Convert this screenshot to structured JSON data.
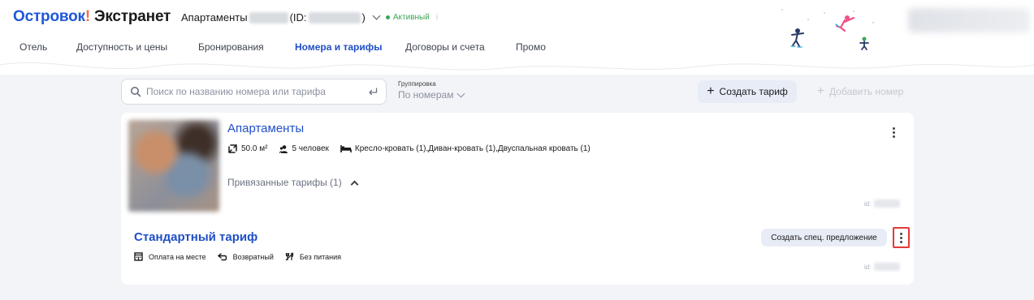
{
  "header": {
    "brand": "Островок",
    "brand_excl": "!",
    "product": "Экстранет",
    "property_type": "Апартаменты",
    "id_prefix": "(ID:",
    "id_suffix": ")",
    "status": "Активный",
    "info_icon": "i"
  },
  "nav": {
    "tabs": [
      {
        "label": "Отель",
        "active": false
      },
      {
        "label": "Доступность и цены",
        "active": false
      },
      {
        "label": "Бронирования",
        "active": false
      },
      {
        "label": "Номера и тарифы",
        "active": true
      },
      {
        "label": "Договоры и счета",
        "active": false
      },
      {
        "label": "Промо",
        "active": false
      }
    ]
  },
  "toolbar": {
    "search_placeholder": "Поиск по названию номера или тарифа",
    "grouping_label": "Группировка",
    "grouping_value": "По номерам",
    "create_tariff_label": "Создать тариф",
    "add_room_label": "Добавить номер"
  },
  "room": {
    "title": "Апартаменты",
    "area": "50.0 м²",
    "guests": "5 человек",
    "beds": "Кресло-кровать (1),Диван-кровать (1),Двуспальная кровать (1)",
    "linked_tariffs": "Привязанные тарифы (1)",
    "id_label": "id:"
  },
  "tariff": {
    "title": "Стандартный тариф",
    "payment": "Оплата на месте",
    "refund": "Возвратный",
    "meal": "Без питания",
    "special_offer_label": "Создать спец. предложение",
    "id_label": "id:"
  },
  "colors": {
    "accent": "#1f4fc7",
    "brand": "#1f58d8",
    "status": "#3aa655",
    "highlight": "#e53935"
  }
}
